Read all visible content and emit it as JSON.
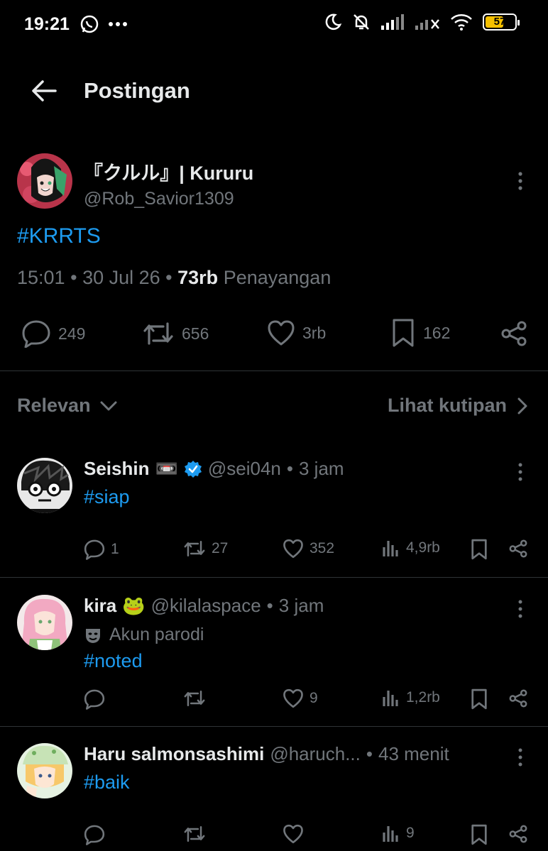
{
  "status_bar": {
    "time": "19:21",
    "battery": "57",
    "icons": [
      "whatsapp-icon",
      "more-dots-icon",
      "moon-icon",
      "bell-off-icon",
      "signal-icon",
      "signal-no-icon",
      "wifi-icon",
      "battery-icon"
    ]
  },
  "header": {
    "title": "Postingan"
  },
  "post": {
    "author_name": "『クルル』| Kururu",
    "author_handle": "@Rob_Savior1309",
    "text": "#KRRTS",
    "time": "15:01",
    "date": "30 Jul 26",
    "views_count": "73rb",
    "views_label": "Penayangan",
    "replies": "249",
    "reposts": "656",
    "likes": "3rb",
    "bookmarks": "162"
  },
  "sort": {
    "label": "Relevan",
    "quotes_label": "Lihat kutipan"
  },
  "replies": [
    {
      "name": "Seishin",
      "emoji": "📼",
      "verified": true,
      "handle": "@sei04n",
      "time": "3 jam",
      "text": "#siap",
      "replies": "1",
      "reposts": "27",
      "likes": "352",
      "views": "4,9rb"
    },
    {
      "name": "kira",
      "emoji": "🐸",
      "handle": "@kilalaspace",
      "time": "3 jam",
      "label": "Akun parodi",
      "text": "#noted",
      "replies": "",
      "reposts": "",
      "likes": "9",
      "views": "1,2rb"
    },
    {
      "name": "Haru salmonsashimi",
      "handle": "@haruch...",
      "time": "43 menit",
      "text": "#baik",
      "replies": "",
      "reposts": "",
      "likes": "",
      "views": "9"
    }
  ],
  "separator": "•",
  "colors": {
    "accent": "#1d9bf0",
    "muted": "#71767b",
    "text": "#e7e9ea",
    "divider": "#2f3336"
  }
}
